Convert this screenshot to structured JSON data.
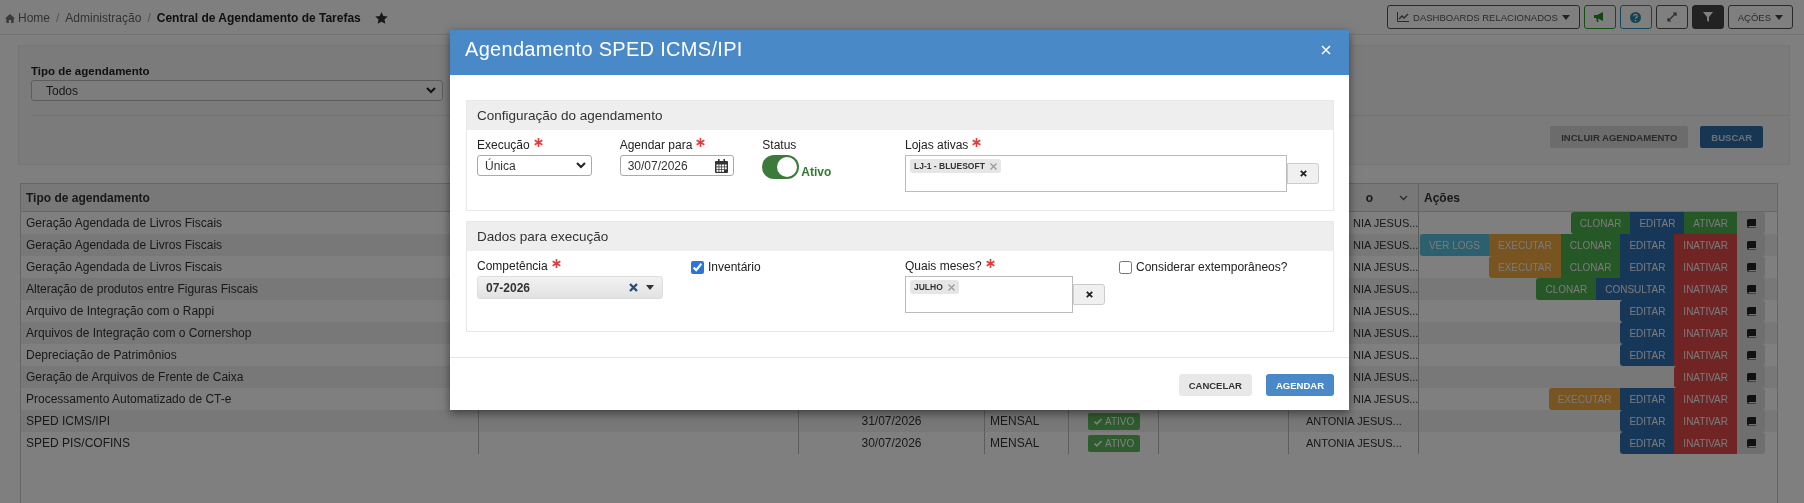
{
  "breadcrumb": [
    {
      "label": "Home",
      "kind": "home"
    },
    {
      "label": "/",
      "kind": "separator"
    },
    {
      "label": "Administração",
      "kind": "link"
    },
    {
      "label": "/",
      "kind": "separator"
    },
    {
      "label": "Central de Agendamento de Tarefas",
      "kind": "current"
    }
  ],
  "toolbar": [
    {
      "kind": "dashboards",
      "label": "DASHBOARDS RELACIONADOS"
    },
    {
      "kind": "announce"
    },
    {
      "kind": "help"
    },
    {
      "kind": "expand"
    },
    {
      "kind": "filter"
    },
    {
      "kind": "actions",
      "label": "AÇÕES"
    }
  ],
  "filter": {
    "label": "Tipo de agendamento",
    "value": "Todos",
    "buttons": [
      {
        "label": "INCLUIR AGENDAMENTO",
        "kind": "default"
      },
      {
        "label": "BUSCAR",
        "kind": "primary"
      }
    ]
  },
  "table": {
    "columns": [
      {
        "label": "Tipo de agendamento"
      },
      {},
      {},
      {},
      {},
      {},
      {
        "label": "o",
        "sortable": true
      },
      {
        "label": "Ações"
      }
    ],
    "rows": [
      {
        "type": "Geração Agendada de Livros Fiscais",
        "user": "NIA JESUS...",
        "actions": [
          {
            "label": "CLONAR",
            "kind": "success"
          },
          {
            "label": "EDITAR",
            "kind": "primary"
          },
          {
            "label": "ATIVAR",
            "kind": "success"
          }
        ]
      },
      {
        "type": "Geração Agendada de Livros Fiscais",
        "user": "NIA JESUS...",
        "actions": [
          {
            "label": "VER LOGS",
            "kind": "info"
          },
          {
            "label": "EXECUTAR",
            "kind": "warning"
          },
          {
            "label": "CLONAR",
            "kind": "success"
          },
          {
            "label": "EDITAR",
            "kind": "primary"
          },
          {
            "label": "INATIVAR",
            "kind": "danger"
          }
        ]
      },
      {
        "type": "Geração Agendada de Livros Fiscais",
        "user": "NIA JESUS...",
        "actions": [
          {
            "label": "EXECUTAR",
            "kind": "warning"
          },
          {
            "label": "CLONAR",
            "kind": "success"
          },
          {
            "label": "EDITAR",
            "kind": "primary"
          },
          {
            "label": "INATIVAR",
            "kind": "danger"
          }
        ]
      },
      {
        "type": "Alteração de produtos entre Figuras Fiscais",
        "user": "NIA JESUS...",
        "actions": [
          {
            "label": "CLONAR",
            "kind": "success"
          },
          {
            "label": "CONSULTAR",
            "kind": "primary"
          },
          {
            "label": "INATIVAR",
            "kind": "danger"
          }
        ]
      },
      {
        "type": "Arquivo de Integração com o Rappi",
        "user": "NIA JESUS...",
        "actions": [
          {
            "label": "EDITAR",
            "kind": "primary"
          },
          {
            "label": "INATIVAR",
            "kind": "danger"
          }
        ]
      },
      {
        "type": "Arquivos de Integração com o Cornershop",
        "user": "NIA JESUS...",
        "actions": [
          {
            "label": "EDITAR",
            "kind": "primary"
          },
          {
            "label": "INATIVAR",
            "kind": "danger"
          }
        ]
      },
      {
        "type": "Depreciação de Patrimônios",
        "user": "NIA JESUS...",
        "actions": [
          {
            "label": "EDITAR",
            "kind": "primary"
          },
          {
            "label": "INATIVAR",
            "kind": "danger"
          }
        ]
      },
      {
        "type": "Geração de Arquivos de Frente de Caixa",
        "user": "NIA JESUS...",
        "actions": [
          {
            "label": "INATIVAR",
            "kind": "danger"
          }
        ]
      },
      {
        "type": "Processamento Automatizado de CT-e",
        "user": "NIA JESUS...",
        "actions": [
          {
            "label": "EXECUTAR",
            "kind": "warning"
          },
          {
            "label": "EDITAR",
            "kind": "primary"
          },
          {
            "label": "INATIVAR",
            "kind": "danger"
          }
        ]
      },
      {
        "type": "SPED ICMS/IPI",
        "date": "31/07/2026",
        "period": "MENSAL",
        "status": "ATIVO",
        "user": "ANTONIA JESUS...",
        "actions": [
          {
            "label": "EDITAR",
            "kind": "primary"
          },
          {
            "label": "INATIVAR",
            "kind": "danger"
          }
        ]
      },
      {
        "type": "SPED PIS/COFINS",
        "date": "30/07/2026",
        "period": "MENSAL",
        "status": "ATIVO",
        "user": "ANTONIA JESUS...",
        "actions": [
          {
            "label": "EDITAR",
            "kind": "primary"
          },
          {
            "label": "INATIVAR",
            "kind": "danger"
          }
        ]
      }
    ]
  },
  "modal": {
    "title": "Agendamento SPED ICMS/IPI",
    "sections": [
      {
        "title": "Configuração do agendamento",
        "fields": [
          {
            "kind": "select",
            "label": "Execução",
            "required": true,
            "value": "Única"
          },
          {
            "kind": "date",
            "label": "Agendar para",
            "required": true,
            "value": "30/07/2026"
          },
          {
            "kind": "toggle",
            "label": "Status",
            "on": true,
            "state_label": "Ativo"
          },
          {
            "kind": "tags",
            "label": "Lojas ativas",
            "required": true,
            "tags": [
              "LJ-1 - BLUESOFT"
            ]
          }
        ]
      },
      {
        "title": "Dados para execução",
        "fields": [
          {
            "kind": "combo",
            "label": "Competência",
            "required": true,
            "value": "07-2026"
          },
          {
            "kind": "checkbox",
            "label": "Inventário",
            "checked": true
          },
          {
            "kind": "tags",
            "label": "Quais meses?",
            "required": true,
            "tags": [
              "JULHO"
            ]
          },
          {
            "kind": "checkbox",
            "label": "Considerar extemporâneos?",
            "checked": false
          }
        ]
      }
    ],
    "buttons": [
      {
        "label": "CANCELAR",
        "kind": "default"
      },
      {
        "label": "AGENDAR",
        "kind": "primary"
      }
    ]
  }
}
